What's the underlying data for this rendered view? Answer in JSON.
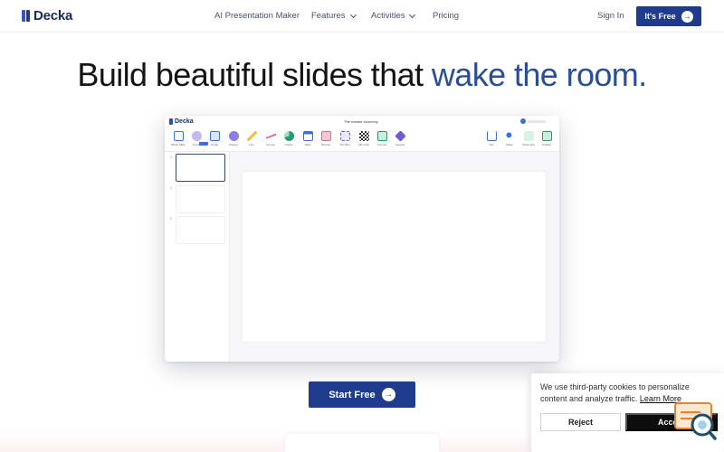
{
  "brand": {
    "name": "Decka"
  },
  "nav": {
    "links": [
      {
        "label": "AI Presentation Maker"
      },
      {
        "label": "Features"
      },
      {
        "label": "Activities"
      },
      {
        "label": "Pricing"
      }
    ],
    "signin": "Sign In",
    "cta": "It's Free"
  },
  "hero": {
    "title_plain": "Build beautiful slides that",
    "title_accent": "wake the room."
  },
  "mock": {
    "logo": "Decka",
    "doc_title": "The creator economy",
    "tools_left": [
      "Blank Slide",
      "Notes",
      "Image",
      "Shapes",
      "Line",
      "Curves",
      "Charts",
      "Table",
      "Biomed",
      "Text Box",
      "QR code",
      "Frames",
      "Layouts"
    ],
    "tools_right": [
      "Get",
      "Share",
      "Share link",
      "Publish"
    ],
    "thumbnails": [
      "1",
      "2",
      "3"
    ]
  },
  "cta": {
    "label": "Start Free"
  },
  "cookie": {
    "text": "We use third-party cookies to personalize content and analyze traffic.",
    "learn_more": "Learn More",
    "reject": "Reject",
    "accept": "Accept"
  },
  "colors": {
    "accent": "#1f3c8c",
    "accent_text": "#2a4f96"
  }
}
